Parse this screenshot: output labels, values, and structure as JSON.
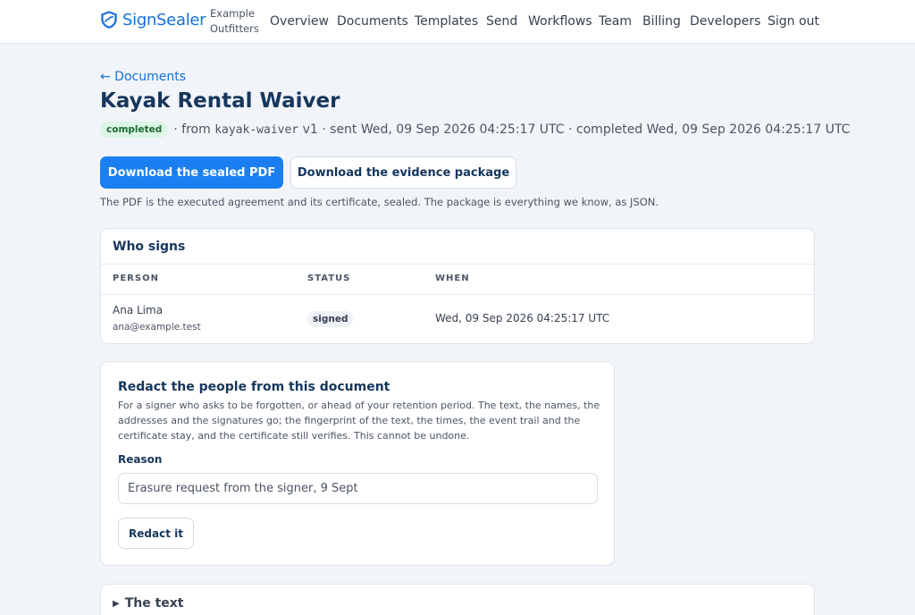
{
  "brand": {
    "name": "SignSealer",
    "icon": "shield-icon",
    "color": "#1570d6"
  },
  "org": {
    "line1": "Example",
    "line2": "Outfitters"
  },
  "nav": [
    "Overview",
    "Documents",
    "Templates",
    "Send",
    "Workflows",
    "Team",
    "Billing",
    "Developers",
    "Sign out"
  ],
  "breadcrumb": {
    "back_label": "← Documents"
  },
  "document": {
    "title": "Kayak Rental Waiver",
    "status": "completed",
    "from_prefix": "· from",
    "template_name": "kayak-waiver",
    "template_version": "v1",
    "sent": "· sent Wed, 09 Sep 2026 04:25:17 UTC",
    "completed": "· completed Wed, 09 Sep 2026 04:25:17 UTC"
  },
  "actions": {
    "download_pdf": "Download the sealed PDF",
    "download_evidence": "Download the evidence package",
    "note": "The PDF is the executed agreement and its certificate, sealed. The package is everything we know, as JSON."
  },
  "signers": {
    "heading": "Who signs",
    "columns": [
      "PERSON",
      "STATUS",
      "WHEN"
    ],
    "rows": [
      {
        "name": "Ana Lima",
        "email": "ana@example.test",
        "status": "signed",
        "when": "Wed, 09 Sep 2026 04:25:17 UTC"
      }
    ]
  },
  "redact": {
    "title": "Redact the people from this document",
    "description": "For a signer who asks to be forgotten, or ahead of your retention period. The text, the names, the addresses and the signatures go; the fingerprint of the text, the times, the event trail and the certificate stay, and the certificate still verifies. This cannot be undone.",
    "reason_label": "Reason",
    "reason_value": "Erasure request from the signer, 9 Sept",
    "button_label": "Redact it"
  },
  "text_section": {
    "label": "The text"
  },
  "colors": {
    "primary": "#1b7ff1",
    "heading": "#16365c",
    "success_bg": "#dcf5e4",
    "success_text": "#1b6b37"
  }
}
